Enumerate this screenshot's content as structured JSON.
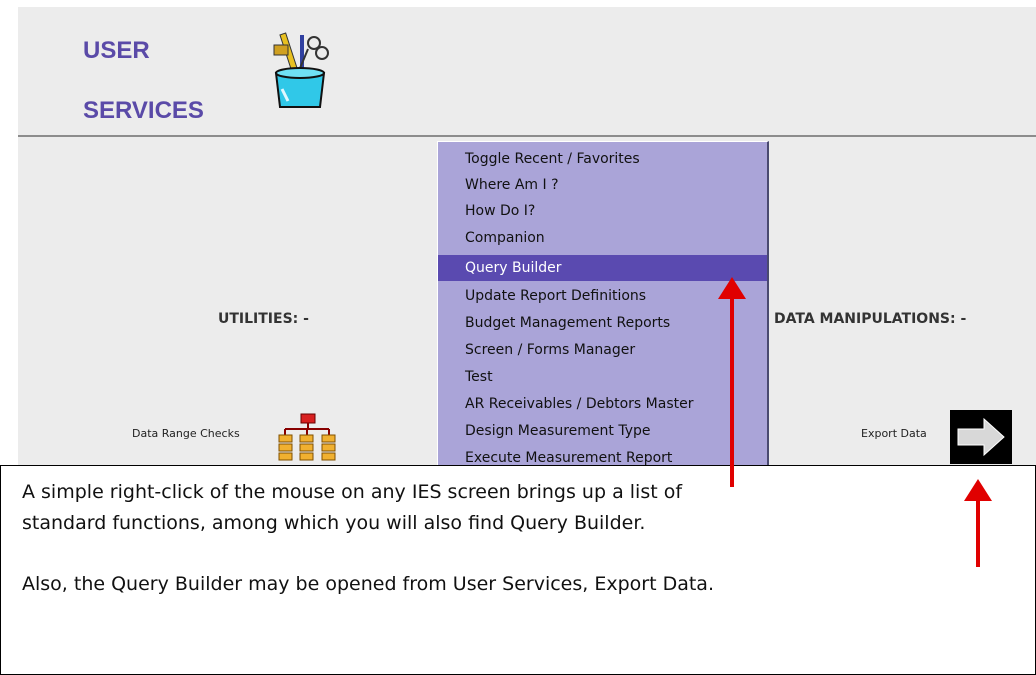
{
  "header": {
    "title_line1": "USER",
    "title_line2": "SERVICES",
    "icon": "tools-cup-icon"
  },
  "utilities": {
    "label": "UTILITIES: -",
    "item_label": "Data Range Checks",
    "item_icon": "hierarchy-chart-icon"
  },
  "data_manipulations": {
    "label": "DATA MANIPULATIONS: -",
    "item_label": "Export Data",
    "item_icon": "right-arrow-icon"
  },
  "context_menu": {
    "items": [
      "Toggle Recent / Favorites",
      "Where Am I ?",
      "How Do I?",
      "Companion",
      "Query Builder",
      "Update Report Definitions",
      "Budget Management Reports",
      "Screen / Forms Manager",
      "Test",
      "AR Receivables / Debtors Master",
      "Design Measurement Type",
      "Execute Measurement Report"
    ],
    "highlighted": "Query Builder"
  },
  "note": {
    "line1": "A simple right-click of the mouse on any IES screen brings up a list of",
    "line2": "standard functions, among which you will also find Query Builder.",
    "line3": "Also, the Query Builder may be opened from User Services, Export Data."
  },
  "colors": {
    "title": "#5a4aa8",
    "menu_bg": "#aaa4d8",
    "menu_highlight": "#5a4ab0",
    "arrow": "#e00000"
  }
}
